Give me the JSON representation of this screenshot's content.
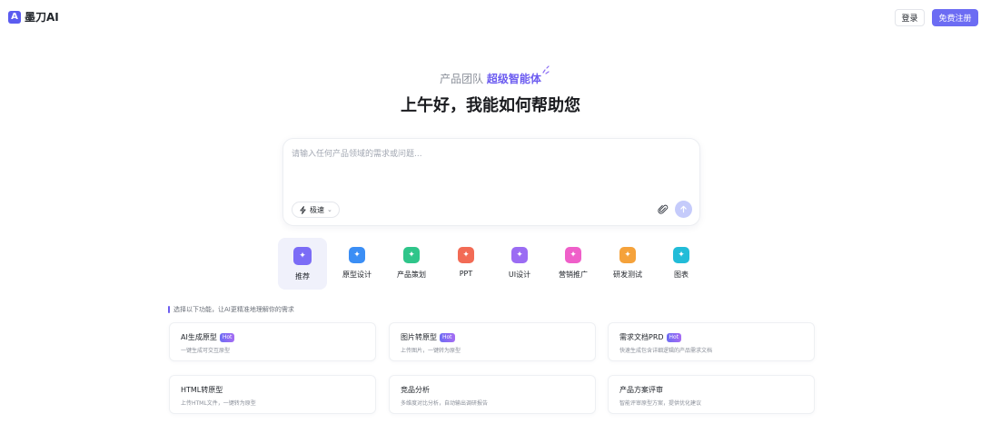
{
  "header": {
    "logo_mark": "A",
    "brand": "墨刀AI",
    "login_label": "登录",
    "signup_label": "免费注册"
  },
  "hero": {
    "sub_prefix": "产品团队",
    "sub_highlight": "超级智能体",
    "title": "上午好，我能如何帮助您"
  },
  "composer": {
    "placeholder": "请输入任何产品领域的需求或问题...",
    "value": "",
    "mode_label": "极速",
    "attach_icon": "paperclip-icon",
    "send_icon": "arrow-up-icon"
  },
  "categories": [
    {
      "label": "推荐",
      "icon": "sparkle-icon",
      "color": "#7b6cf6",
      "active": true
    },
    {
      "label": "原型设计",
      "icon": "layout-icon",
      "color": "#3b8ef5",
      "active": false
    },
    {
      "label": "产品策划",
      "icon": "doc-icon",
      "color": "#2fc58a",
      "active": false
    },
    {
      "label": "PPT",
      "icon": "slides-icon",
      "color": "#f26b55",
      "active": false
    },
    {
      "label": "UI设计",
      "icon": "pen-icon",
      "color": "#9b6cf3",
      "active": false
    },
    {
      "label": "营销推广",
      "icon": "target-icon",
      "color": "#ef5fc9",
      "active": false
    },
    {
      "label": "研发测试",
      "icon": "chat-icon",
      "color": "#f5a23b",
      "active": false
    },
    {
      "label": "图表",
      "icon": "tree-icon",
      "color": "#22bcd8",
      "active": false
    }
  ],
  "hint": "选择以下功能，让AI更精准地理解你的需求",
  "hot_label": "Hot",
  "features": [
    {
      "title": "AI生成原型",
      "hot": true,
      "desc": "一键生成可交互原型"
    },
    {
      "title": "图片转原型",
      "hot": true,
      "desc": "上传图片，一键转为原型"
    },
    {
      "title": "需求文档PRD",
      "hot": true,
      "desc": "快速生成包含详细逻辑的产品需求文档"
    },
    {
      "title": "HTML转原型",
      "hot": false,
      "desc": "上传HTML文件，一键转为原型"
    },
    {
      "title": "竞品分析",
      "hot": false,
      "desc": "多维度对比分析，自动输出调研报告"
    },
    {
      "title": "产品方案评审",
      "hot": false,
      "desc": "智能评审原型方案，提供优化建议"
    }
  ],
  "colors": {
    "accent": "#6c6cf3",
    "highlight": "#6c5cf0",
    "send_disabled": "#c5cbfb"
  }
}
